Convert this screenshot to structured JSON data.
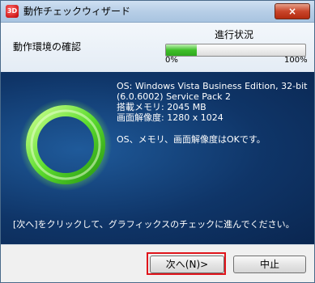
{
  "window": {
    "title": "動作チェックウィザード",
    "app_icon_text": "3D",
    "close_glyph": "×"
  },
  "top": {
    "environment_check_label": "動作環境の確認",
    "progress": {
      "label": "進行状況",
      "min_label": "0%",
      "max_label": "100%",
      "fraction": 0.22
    }
  },
  "info": {
    "os_line1": "OS: Windows Vista Business Edition, 32-bit",
    "os_line2": "(6.0.6002) Service Pack 2",
    "memory": "搭載メモリ: 2045 MB",
    "resolution": "画面解像度: 1280 x 1024",
    "result": "OS、メモリ、画面解像度はOKです。"
  },
  "instruction": "[次へ]をクリックして、グラフィックスのチェックに進んでください。",
  "buttons": {
    "next": "次へ(N)>",
    "cancel": "中止"
  },
  "colors": {
    "ring_green": "#5ddc2f",
    "panel_blue": "#0f3568",
    "focus_red": "#e0141b"
  }
}
